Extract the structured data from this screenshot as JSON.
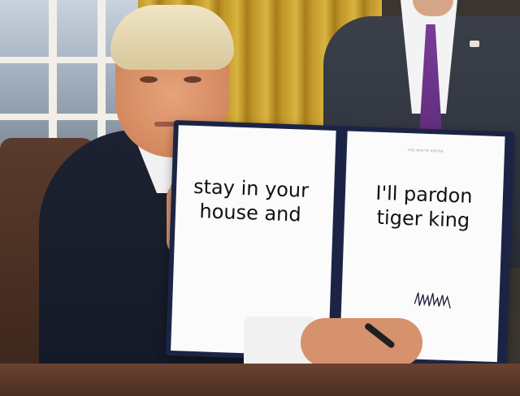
{
  "document": {
    "left_page_text": "stay in your\nhouse and",
    "right_page_text": "I'll pardon\ntiger king",
    "header_text": "THE WHITE HOUSE"
  },
  "colors": {
    "folder": "#1c2446",
    "page": "#fbfbfb",
    "tie": "#6b3390",
    "curtain": "#c99f30"
  }
}
